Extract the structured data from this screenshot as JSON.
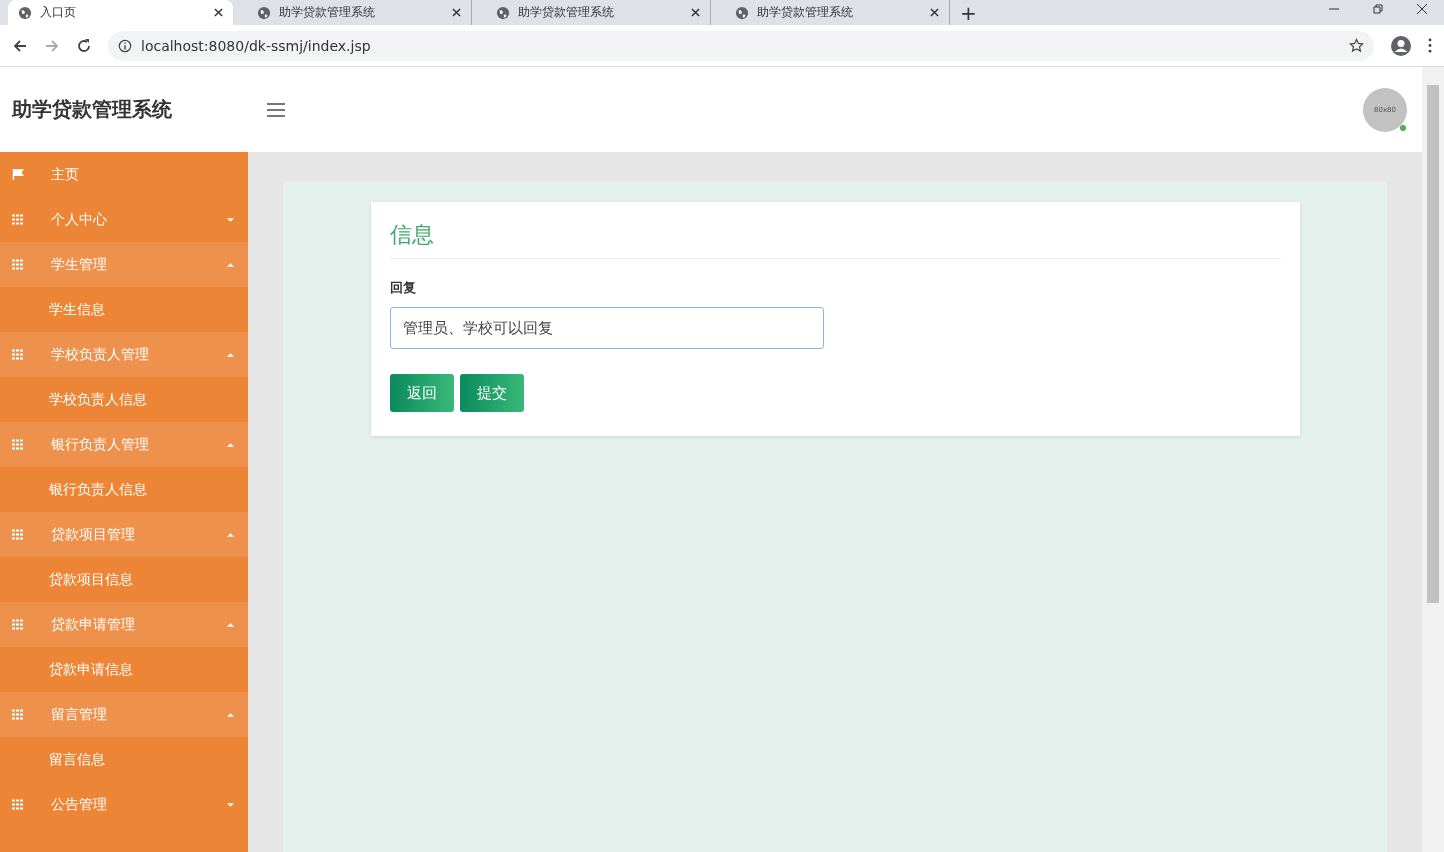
{
  "browser": {
    "tabs": [
      {
        "title": "入口页",
        "selected": true
      },
      {
        "title": "助学贷款管理系统",
        "selected": false
      },
      {
        "title": "助学贷款管理系统",
        "selected": false
      },
      {
        "title": "助学贷款管理系统",
        "selected": false
      }
    ],
    "new_tab": "+",
    "url": "localhost:8080/dk-ssmj/index.jsp"
  },
  "header": {
    "title": "助学贷款管理系统",
    "avatar": "80x80"
  },
  "sidebar": {
    "items": [
      {
        "kind": "link",
        "label": "主页"
      },
      {
        "kind": "group",
        "label": "个人中心",
        "expanded": false
      },
      {
        "kind": "group",
        "label": "学生管理",
        "expanded": true,
        "children": [
          {
            "label": "学生信息"
          }
        ]
      },
      {
        "kind": "group",
        "label": "学校负责人管理",
        "expanded": true,
        "children": [
          {
            "label": "学校负责人信息"
          }
        ]
      },
      {
        "kind": "group",
        "label": "银行负责人管理",
        "expanded": true,
        "children": [
          {
            "label": "银行负责人信息"
          }
        ]
      },
      {
        "kind": "group",
        "label": "贷款项目管理",
        "expanded": true,
        "children": [
          {
            "label": "贷款项目信息"
          }
        ]
      },
      {
        "kind": "group",
        "label": "贷款申请管理",
        "expanded": true,
        "children": [
          {
            "label": "贷款申请信息"
          }
        ]
      },
      {
        "kind": "group",
        "label": "留言管理",
        "expanded": true,
        "children": [
          {
            "label": "留言信息"
          }
        ]
      },
      {
        "kind": "group",
        "label": "公告管理",
        "expanded": false
      }
    ]
  },
  "form": {
    "title": "信息",
    "field_label": "回复",
    "field_value": "管理员、学校可以回复",
    "buttons": [
      "返回",
      "提交"
    ]
  }
}
